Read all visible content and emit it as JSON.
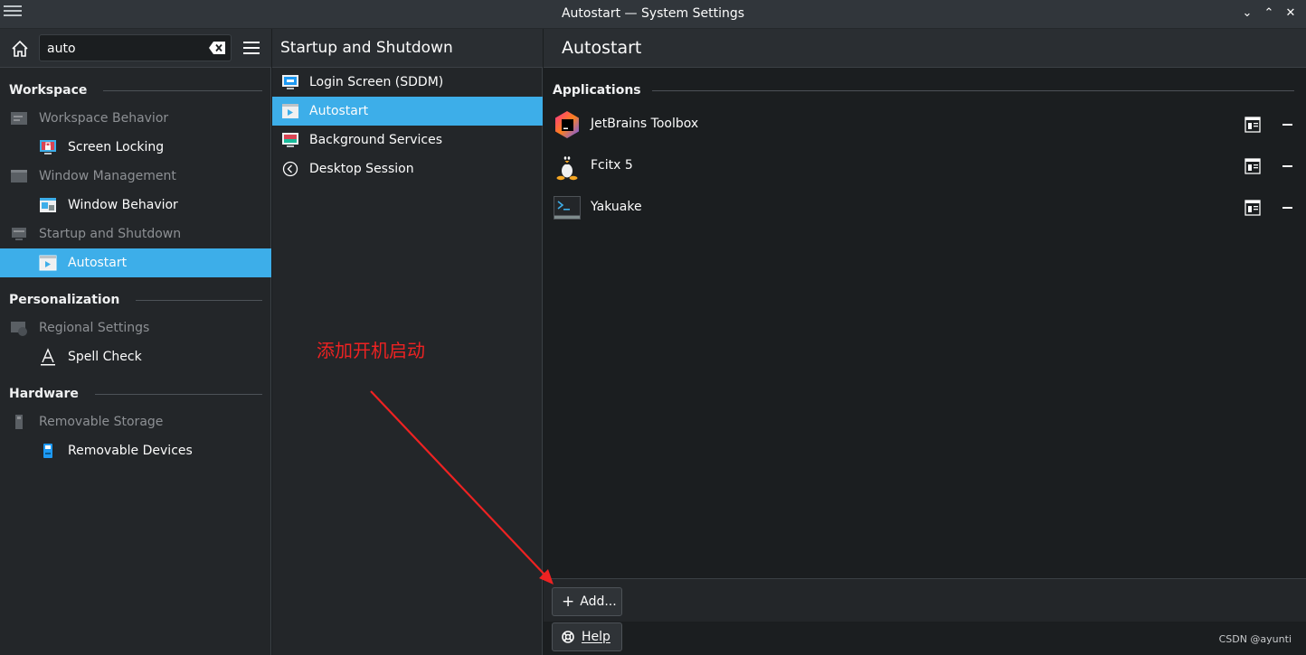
{
  "window": {
    "title": "Autostart — System Settings"
  },
  "search": {
    "value": "auto"
  },
  "sidebar": {
    "categories": [
      {
        "label": "Workspace"
      },
      {
        "label": "Personalization"
      },
      {
        "label": "Hardware"
      }
    ],
    "items": [
      {
        "label": "Workspace Behavior"
      },
      {
        "label": "Screen Locking"
      },
      {
        "label": "Window Management"
      },
      {
        "label": "Window Behavior"
      },
      {
        "label": "Startup and Shutdown"
      },
      {
        "label": "Autostart"
      },
      {
        "label": "Regional Settings"
      },
      {
        "label": "Spell Check"
      },
      {
        "label": "Removable Storage"
      },
      {
        "label": "Removable Devices"
      }
    ]
  },
  "subpanel": {
    "title": "Startup and Shutdown",
    "items": [
      {
        "label": "Login Screen (SDDM)"
      },
      {
        "label": "Autostart"
      },
      {
        "label": "Background Services"
      },
      {
        "label": "Desktop Session"
      }
    ]
  },
  "main": {
    "title": "Autostart",
    "section": "Applications",
    "apps": [
      {
        "name": "JetBrains Toolbox",
        "icon": "jetbrains-toolbox-icon"
      },
      {
        "name": "Fcitx 5",
        "icon": "tux-penguin-icon"
      },
      {
        "name": "Yakuake",
        "icon": "terminal-icon"
      }
    ],
    "add_label": "Add...",
    "help_label": "Help"
  },
  "annotation": {
    "text": "添加开机启动",
    "color": "#ee2222"
  },
  "watermark": {
    "text": "CSDN @ayunti"
  },
  "colors": {
    "accent": "#3daee9",
    "background": "#1b1e20",
    "panel": "#232629"
  }
}
